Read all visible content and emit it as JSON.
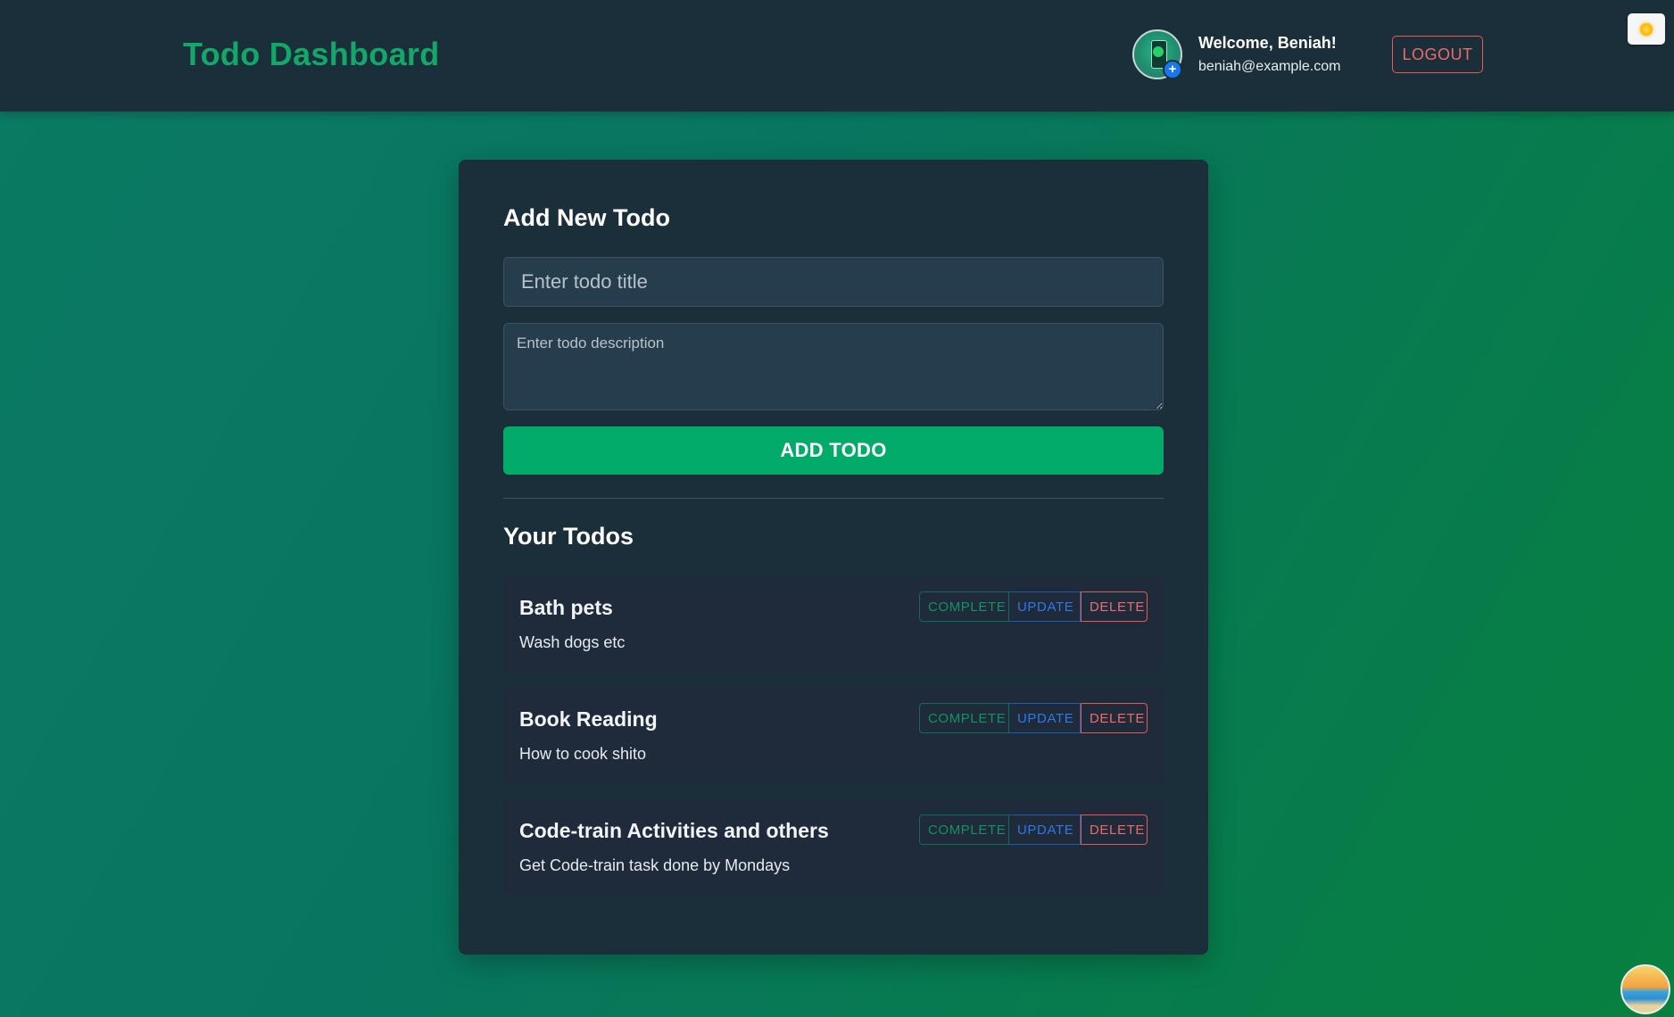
{
  "header": {
    "brand": "Todo Dashboard",
    "welcome": "Welcome, Beniah!",
    "email": "beniah@example.com",
    "logout_label": "LOGOUT",
    "theme_icon": "sun-icon",
    "avatar_icon": "avatar"
  },
  "form": {
    "heading": "Add New Todo",
    "title_placeholder": "Enter todo title",
    "title_value": "",
    "description_placeholder": "Enter todo description",
    "description_value": "",
    "add_label": "ADD TODO"
  },
  "list": {
    "heading": "Your Todos",
    "actions": {
      "complete": "COMPLETE",
      "update": "UPDATE",
      "delete": "DELETE"
    },
    "todos": [
      {
        "title": "Bath pets",
        "description": "Wash dogs etc"
      },
      {
        "title": "Book Reading",
        "description": "How to cook shito"
      },
      {
        "title": "Code-train Activities and others",
        "description": "Get Code-train task done by Mondays"
      }
    ]
  },
  "colors": {
    "brand": "#13a86a",
    "primary_button": "#02ab67",
    "complete": "#13935f",
    "update": "#2f79e6",
    "delete": "#ef6a6a",
    "panel": "#1a2f39"
  }
}
